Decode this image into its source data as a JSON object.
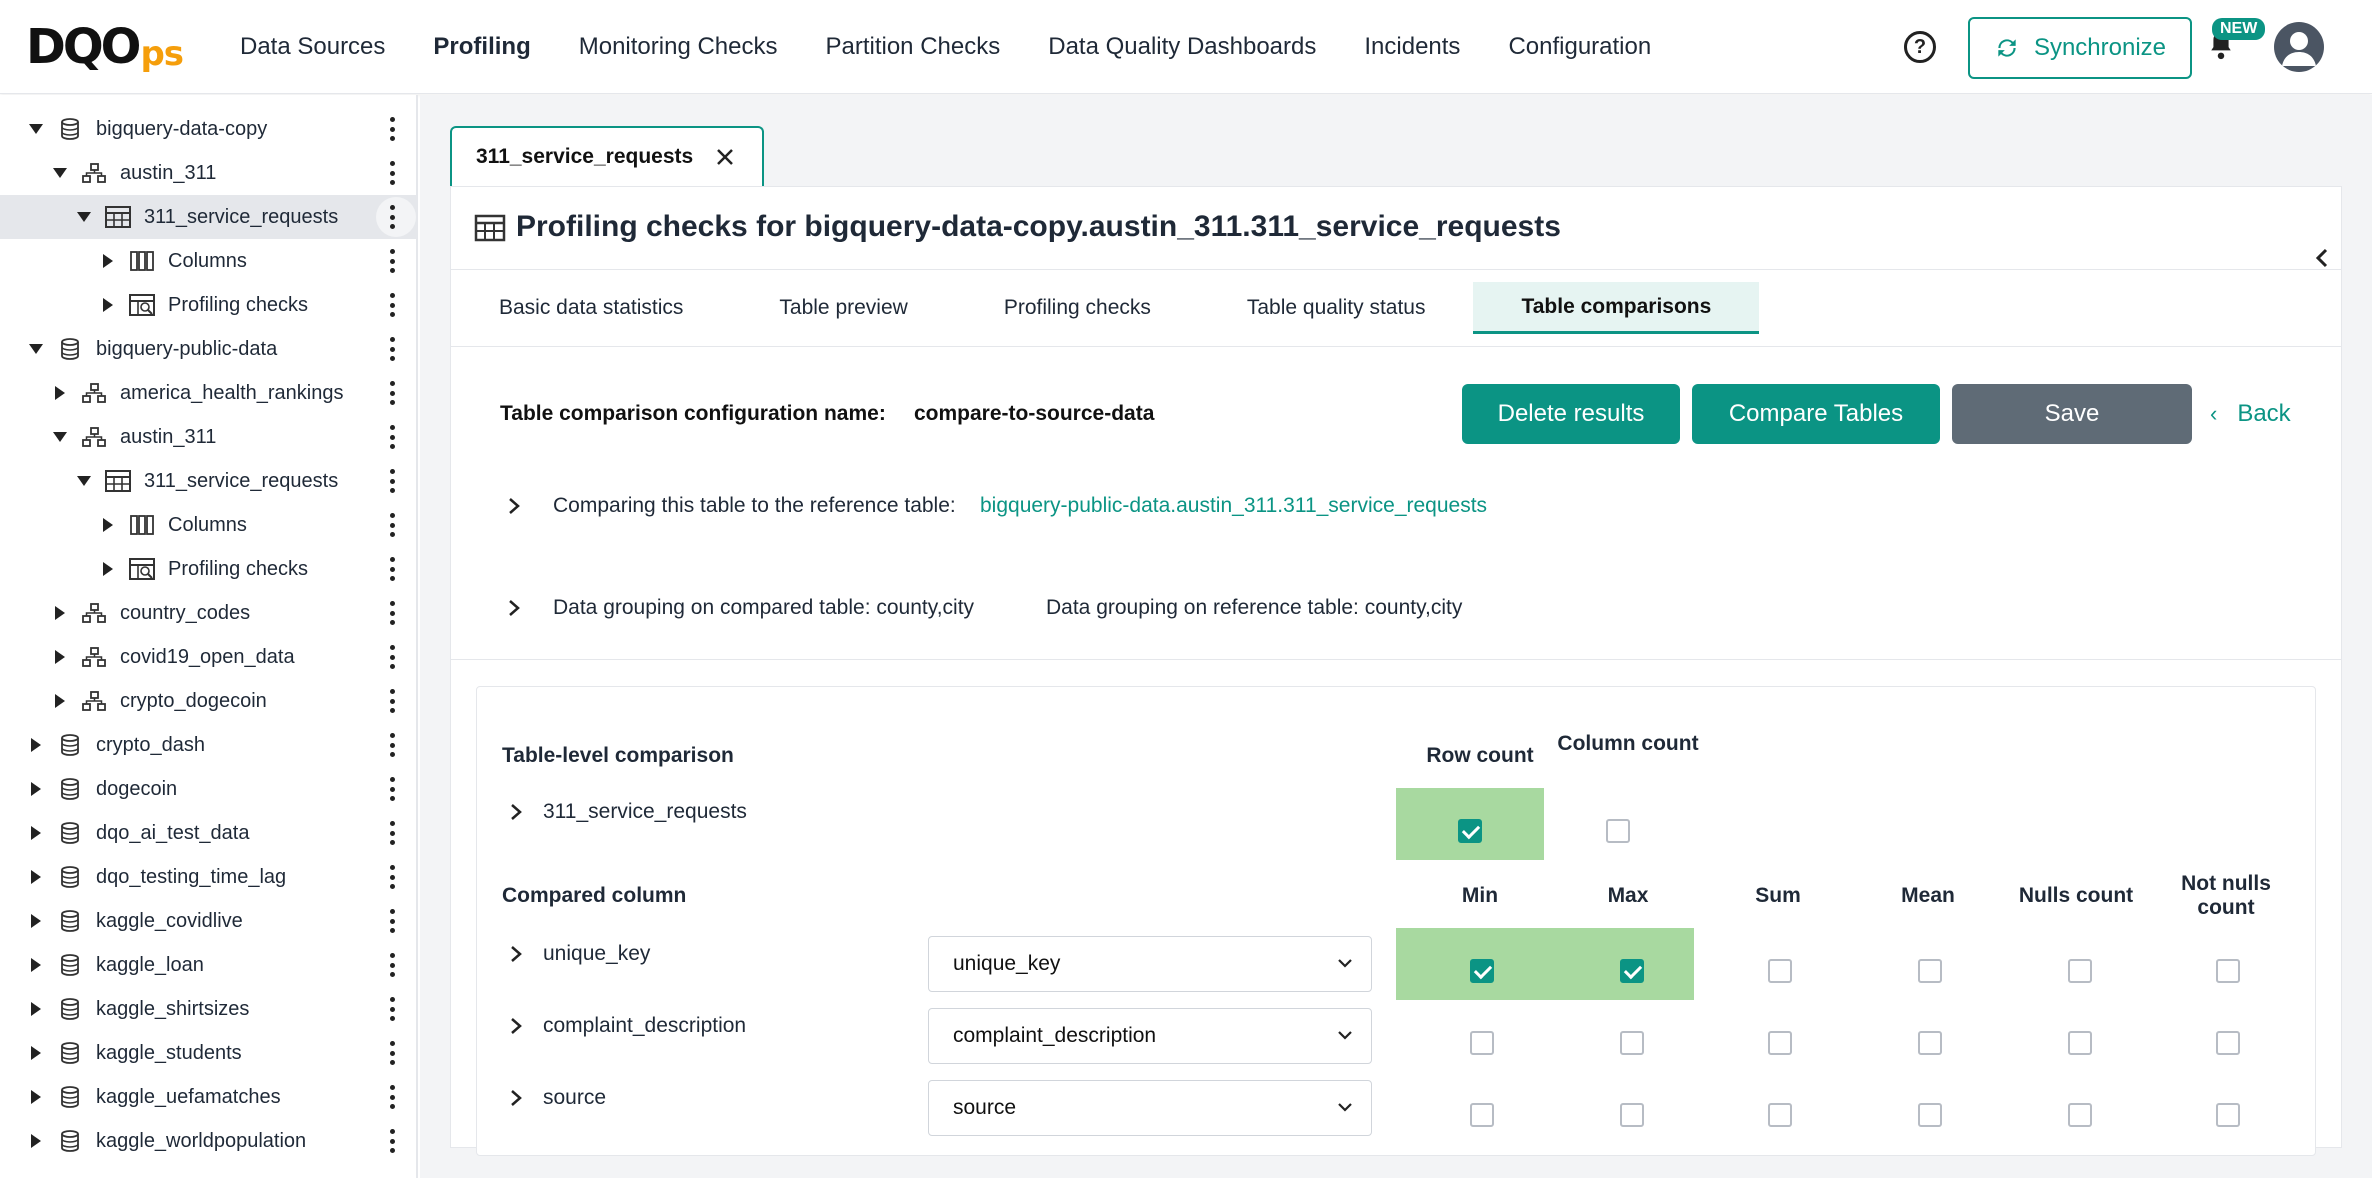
{
  "app": {
    "logo_main": "DQO",
    "logo_sub": "ps"
  },
  "nav": {
    "items": [
      {
        "label": "Data Sources"
      },
      {
        "label": "Profiling"
      },
      {
        "label": "Monitoring Checks"
      },
      {
        "label": "Partition Checks"
      },
      {
        "label": "Data Quality Dashboards"
      },
      {
        "label": "Incidents"
      },
      {
        "label": "Configuration"
      }
    ],
    "active": "Profiling",
    "help_icon": "?",
    "sync_label": "Synchronize",
    "new_badge": "NEW"
  },
  "sidebar": {
    "rows": [
      {
        "label": "bigquery-data-copy",
        "icon": "database-icon",
        "expanded": true
      },
      {
        "label": "austin_311",
        "icon": "schema-icon",
        "expanded": true
      },
      {
        "label": "311_service_requests",
        "icon": "table-icon",
        "expanded": true,
        "selected": true
      },
      {
        "label": "Columns",
        "icon": "columns-icon",
        "expanded": false
      },
      {
        "label": "Profiling checks",
        "icon": "checks-icon",
        "expanded": false
      },
      {
        "label": "bigquery-public-data",
        "icon": "database-icon",
        "expanded": true
      },
      {
        "label": "america_health_rankings",
        "icon": "schema-icon",
        "expanded": false
      },
      {
        "label": "austin_311",
        "icon": "schema-icon",
        "expanded": true
      },
      {
        "label": "311_service_requests",
        "icon": "table-icon",
        "expanded": true
      },
      {
        "label": "Columns",
        "icon": "columns-icon",
        "expanded": false
      },
      {
        "label": "Profiling checks",
        "icon": "checks-icon",
        "expanded": false
      },
      {
        "label": "country_codes",
        "icon": "schema-icon",
        "expanded": false
      },
      {
        "label": "covid19_open_data",
        "icon": "schema-icon",
        "expanded": false
      },
      {
        "label": "crypto_dogecoin",
        "icon": "schema-icon",
        "expanded": false
      },
      {
        "label": "crypto_dash",
        "icon": "database-icon",
        "expanded": false
      },
      {
        "label": "dogecoin",
        "icon": "database-icon",
        "expanded": false
      },
      {
        "label": "dqo_ai_test_data",
        "icon": "database-icon",
        "expanded": false
      },
      {
        "label": "dqo_testing_time_lag",
        "icon": "database-icon",
        "expanded": false
      },
      {
        "label": "kaggle_covidlive",
        "icon": "database-icon",
        "expanded": false
      },
      {
        "label": "kaggle_loan",
        "icon": "database-icon",
        "expanded": false
      },
      {
        "label": "kaggle_shirtsizes",
        "icon": "database-icon",
        "expanded": false
      },
      {
        "label": "kaggle_students",
        "icon": "database-icon",
        "expanded": false
      },
      {
        "label": "kaggle_uefamatches",
        "icon": "database-icon",
        "expanded": false
      },
      {
        "label": "kaggle_worldpopulation",
        "icon": "database-icon",
        "expanded": false
      }
    ]
  },
  "editor": {
    "open_tab": "311_service_requests",
    "title": "Profiling checks for bigquery-data-copy.austin_311.311_service_requests",
    "subtabs": [
      {
        "label": "Basic data statistics"
      },
      {
        "label": "Table preview"
      },
      {
        "label": "Profiling checks"
      },
      {
        "label": "Table quality status"
      },
      {
        "label": "Table comparisons"
      }
    ],
    "active_subtab": "Table comparisons"
  },
  "comparison": {
    "config_label": "Table comparison configuration name:",
    "config_name": "compare-to-source-data",
    "buttons": {
      "delete": "Delete results",
      "compare": "Compare Tables",
      "save": "Save",
      "back": "Back"
    },
    "reference_label": "Comparing this table to the reference table:",
    "reference_table": "bigquery-public-data.austin_311.311_service_requests",
    "grouping_compared": "Data grouping on compared table: county,city",
    "grouping_reference": "Data grouping on reference table: county,city",
    "table_level": {
      "heading": "Table-level comparison",
      "row_label": "311_service_requests",
      "headers": [
        "Row count",
        "Column count"
      ],
      "checked": [
        true,
        false
      ]
    },
    "columns": {
      "heading": "Compared column",
      "headers": [
        "Min",
        "Max",
        "Sum",
        "Mean",
        "Nulls count",
        "Not nulls count"
      ],
      "rows": [
        {
          "name": "unique_key",
          "reference": "unique_key",
          "checked": [
            true,
            true,
            false,
            false,
            false,
            false
          ]
        },
        {
          "name": "complaint_description",
          "reference": "complaint_description",
          "checked": [
            false,
            false,
            false,
            false,
            false,
            false
          ]
        },
        {
          "name": "source",
          "reference": "source",
          "checked": [
            false,
            false,
            false,
            false,
            false,
            false
          ]
        }
      ]
    },
    "colors": {
      "accent": "#0b9484",
      "save": "#5f6b76",
      "highlight": "#a8d9a0"
    }
  }
}
